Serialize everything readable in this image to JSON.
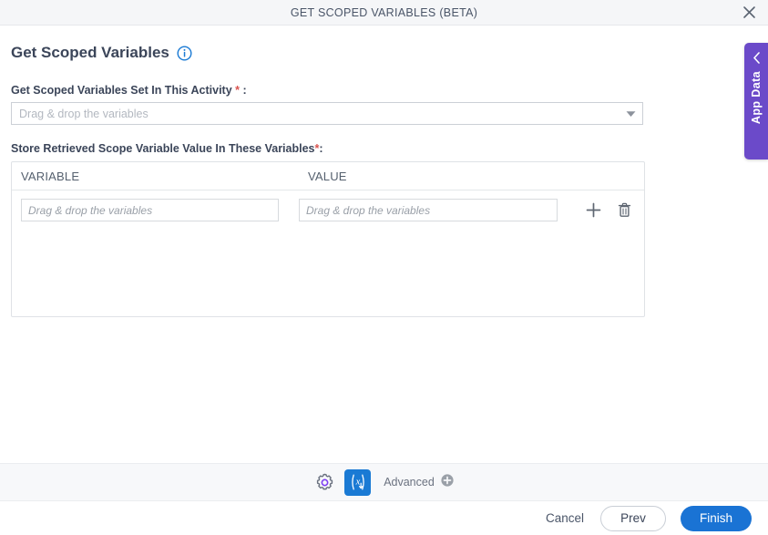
{
  "window": {
    "title": "GET SCOPED VARIABLES (BETA)",
    "close_icon": "close-icon"
  },
  "page": {
    "heading": "Get Scoped Variables",
    "info_icon": "info-icon"
  },
  "form": {
    "scoped_variables_field": {
      "label": "Get Scoped Variables Set In This Activity",
      "required_marker": "*",
      "label_suffix": ":",
      "value": "",
      "placeholder": "Drag & drop the variables",
      "caret_icon": "chevron-down-icon"
    },
    "store_variables_section": {
      "label": "Store Retrieved Scope Variable Value In These Variables",
      "required_marker": "*",
      "label_suffix": ":",
      "columns": [
        "VARIABLE",
        "VALUE"
      ],
      "rows": [
        {
          "variable": "",
          "variable_placeholder": "Drag & drop the variables",
          "value": "",
          "value_placeholder": "Drag & drop the variables",
          "add_icon": "plus-icon",
          "delete_icon": "trash-icon"
        }
      ]
    }
  },
  "app_data_tab": {
    "label": "App Data",
    "chevron_icon": "chevron-left-icon",
    "color": "#6b4ac9"
  },
  "toolbar": {
    "gear_icon": "gear-icon",
    "variables_icon": "variables-x-icon",
    "advanced_label": "Advanced",
    "advanced_add_icon": "plus-circle-icon",
    "accent_color": "#1a7ad4"
  },
  "footer": {
    "cancel_label": "Cancel",
    "prev_label": "Prev",
    "finish_label": "Finish",
    "finish_color": "#1a73d4"
  }
}
